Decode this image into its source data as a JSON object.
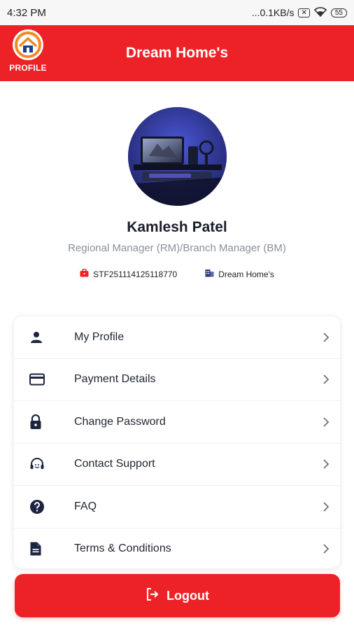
{
  "status_bar": {
    "time": "4:32 PM",
    "network_speed": "...0.1KB/s",
    "sim_icon": "no-sim-icon",
    "wifi_icon": "wifi-icon",
    "battery": "55"
  },
  "app_bar": {
    "logo_label": "PROFILE",
    "title": "Dream Home's"
  },
  "profile": {
    "avatar_icon": "user-avatar-photo",
    "name": "Kamlesh Patel",
    "role": "Regional Manager (RM)/Branch Manager (BM)",
    "staff_id": "STF251114125118770",
    "company": "Dream Home's"
  },
  "menu": {
    "items": [
      {
        "label": "My Profile",
        "icon": "person-icon"
      },
      {
        "label": "Payment Details",
        "icon": "credit-card-icon"
      },
      {
        "label": "Change Password",
        "icon": "lock-icon"
      },
      {
        "label": "Contact Support",
        "icon": "headset-icon"
      },
      {
        "label": "FAQ",
        "icon": "help-icon"
      },
      {
        "label": "Terms & Conditions",
        "icon": "document-icon"
      }
    ]
  },
  "logout": {
    "label": "Logout",
    "icon": "logout-icon"
  },
  "colors": {
    "brand_red": "#ec2227",
    "text_dark": "#1f2530",
    "text_muted": "#8a909a",
    "icon_navy": "#1d2440"
  }
}
